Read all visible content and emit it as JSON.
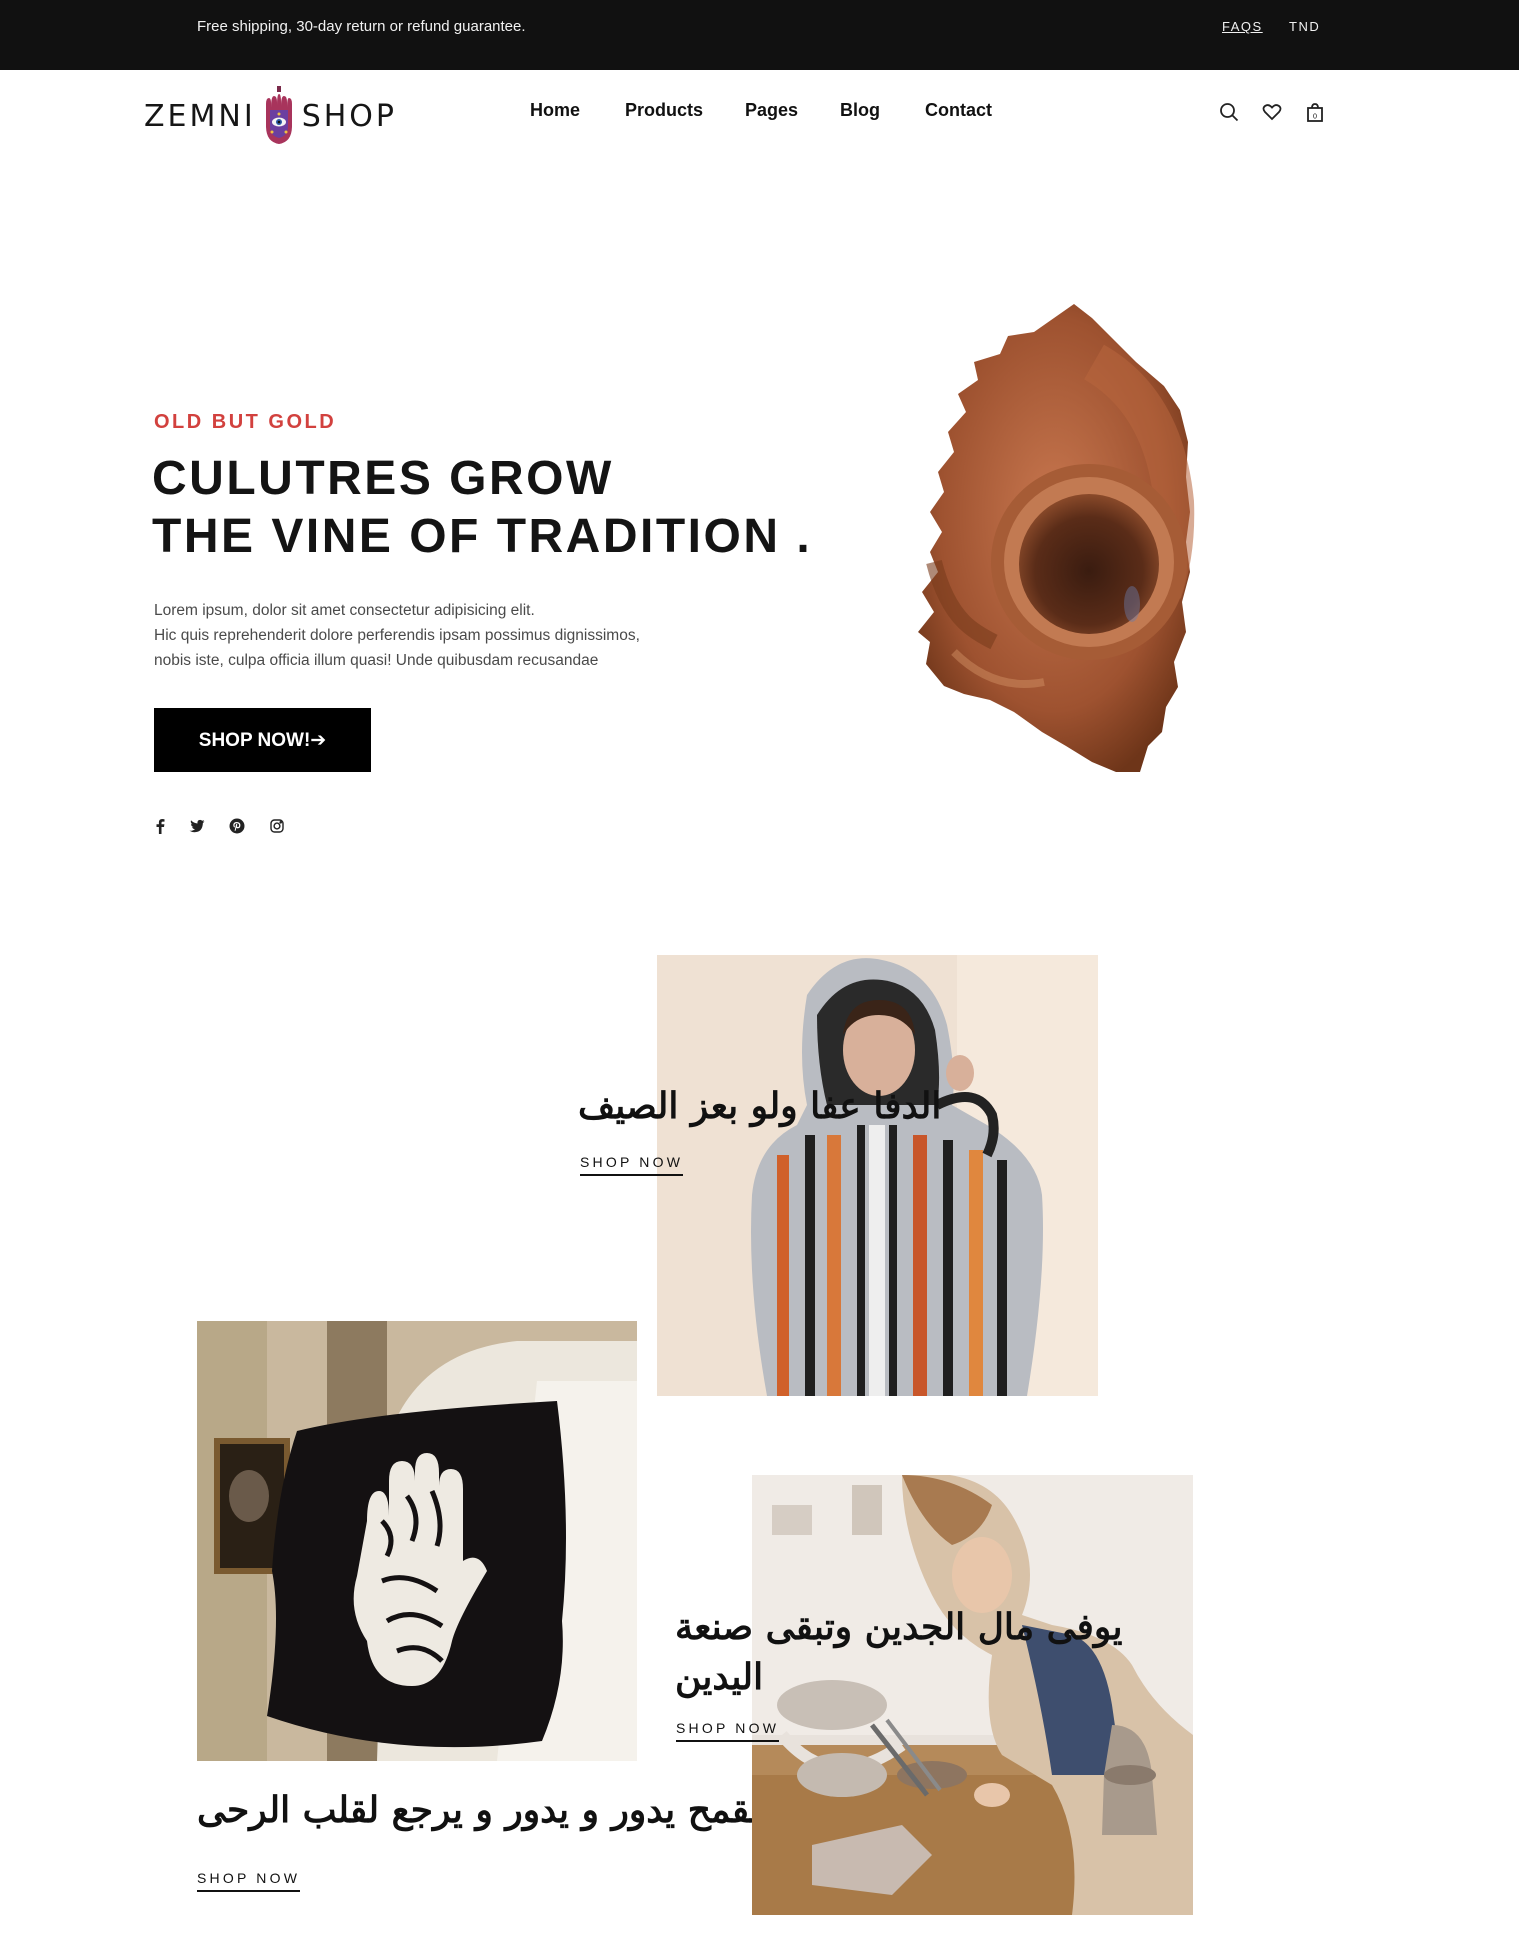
{
  "topbar": {
    "message": "Free shipping, 30-day return or refund guarantee.",
    "faqs_label": "FAQS",
    "currency_label": "TND"
  },
  "header": {
    "logo_left": "ZEMNI",
    "logo_right": "SHOP",
    "nav": [
      "Home",
      "Products",
      "Pages",
      "Blog",
      "Contact"
    ],
    "icons": [
      "search-icon",
      "heart-icon",
      "shopping-bag-icon"
    ]
  },
  "hero": {
    "eyebrow": "OLD BUT GOLD",
    "title_line1": "CULUTRES GROW",
    "title_line2": "THE VINE OF TRADITION .",
    "desc_line1": "Lorem ipsum, dolor sit amet consectetur adipisicing elit.",
    "desc_line2": "Hic quis reprehenderit dolore perferendis ipsam possimus dignissimos,",
    "desc_line3": "nobis iste, culpa officia illum quasi! Unde quibusdam recusandae",
    "button_label": "SHOP NOW!➔",
    "social": [
      "facebook-icon",
      "twitter-icon",
      "pinterest-icon",
      "instagram-icon"
    ],
    "accent_color": "#d2413e"
  },
  "collections": [
    {
      "title": "الدفا عفا ولو بعز الصيف",
      "cta": "SHOP NOW"
    },
    {
      "title": "القمح يدور و يدور و يرجع لقلب الرحى",
      "cta": "SHOP NOW"
    },
    {
      "title_line1": "يوفى مال الجدين وتبقى صنعة",
      "title_line2": "اليدين",
      "cta": "SHOP NOW"
    }
  ]
}
